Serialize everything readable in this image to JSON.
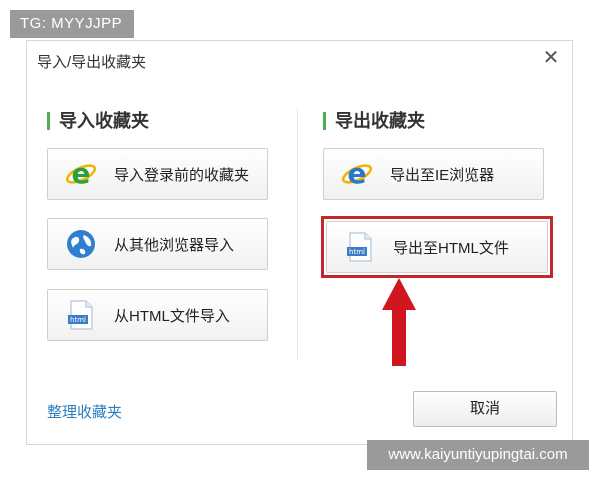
{
  "watermark_top": "TG: MYYJJPP",
  "watermark_bottom": "www.kaiyuntiyupingtai.com",
  "dialog": {
    "title": "导入/导出收藏夹",
    "close_symbol": "✕",
    "import_section": {
      "title": "导入收藏夹",
      "buttons": [
        {
          "label": "导入登录前的收藏夹",
          "icon": "ie-e-icon"
        },
        {
          "label": "从其他浏览器导入",
          "icon": "globe-icon"
        },
        {
          "label": "从HTML文件导入",
          "icon": "html-file-icon"
        }
      ]
    },
    "export_section": {
      "title": "导出收藏夹",
      "buttons": [
        {
          "label": "导出至IE浏览器",
          "icon": "ie-e-icon"
        },
        {
          "label": "导出至HTML文件",
          "icon": "html-file-icon"
        }
      ]
    },
    "footer_link": "整理收藏夹",
    "cancel_label": "取消",
    "html_icon_text": "html"
  },
  "colors": {
    "accent_green": "#4caf50",
    "highlight_red": "#c1272d",
    "link_blue": "#2a7fc1"
  }
}
